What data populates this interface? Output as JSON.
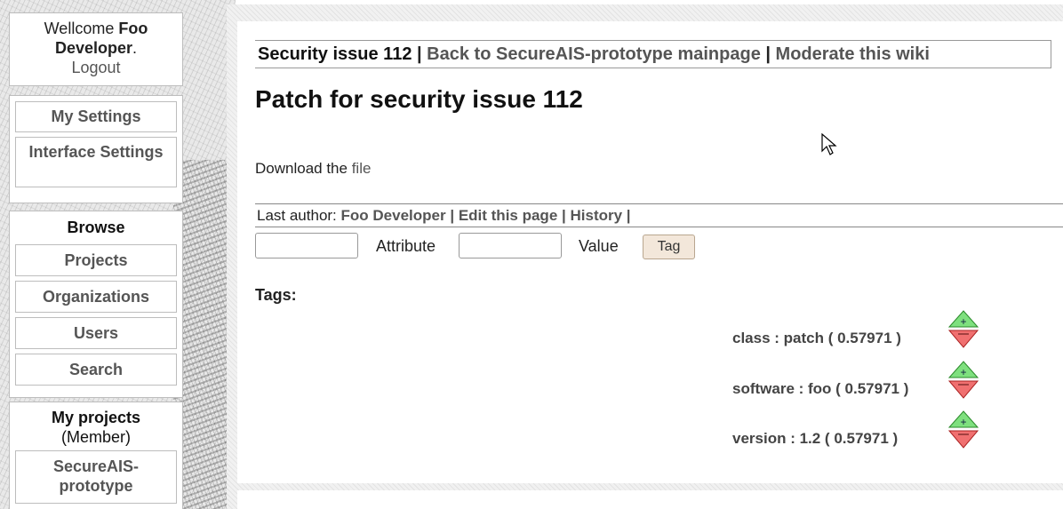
{
  "sidebar": {
    "welcome_prefix": "Wellcome ",
    "user_name": "Foo Developer",
    "welcome_suffix": ".",
    "logout": "Logout",
    "settings": [
      "My Settings",
      "Interface Settings"
    ],
    "browse_title": "Browse",
    "browse_items": [
      "Projects",
      "Organizations",
      "Users",
      "Search"
    ],
    "projects_title": "My projects",
    "projects_sub": "(Member)",
    "projects": [
      "SecureAIS-prototype"
    ]
  },
  "breadcrumb": {
    "current": "Security issue 112",
    "sep1": " | ",
    "back": "Back to SecureAIS-prototype mainpage",
    "sep2": " | ",
    "moderate": "Moderate this wiki"
  },
  "page": {
    "title": "Patch for security issue 112",
    "download_prefix": "Download the ",
    "download_link": "file"
  },
  "meta": {
    "author_prefix": "Last author: ",
    "author": "Foo Developer",
    "sep": " | ",
    "edit": "Edit this page",
    "history": "History",
    "trail": " |"
  },
  "tag_form": {
    "attribute_label": "Attribute",
    "value_label": "Value",
    "submit": "Tag"
  },
  "tags": {
    "title": "Tags:",
    "items": [
      {
        "label": "class : patch ( 0.57971 )"
      },
      {
        "label": "software : foo ( 0.57971 )"
      },
      {
        "label": "version : 1.2 ( 0.57971 )"
      }
    ]
  },
  "colors": {
    "vote_up": "#7ee07e",
    "vote_down": "#f07070"
  }
}
